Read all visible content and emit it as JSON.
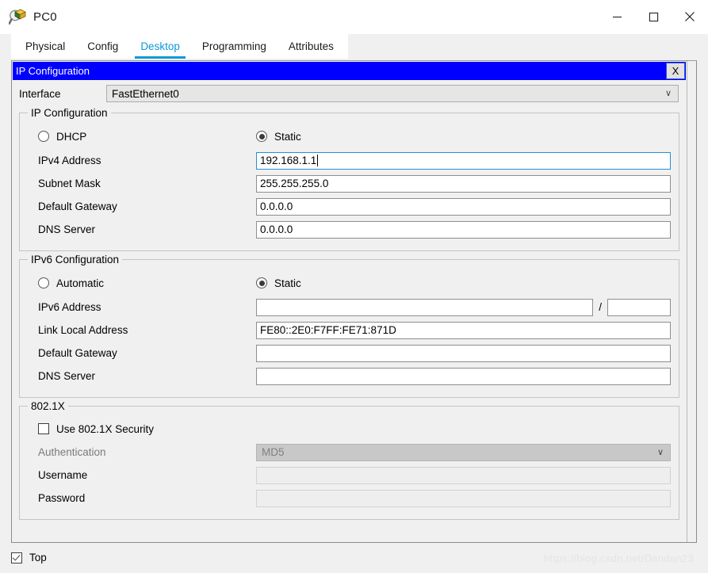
{
  "window": {
    "title": "PC0",
    "icon": "packet-tracer-inspect-icon",
    "controls": {
      "minimize": "—",
      "maximize": "□",
      "close": "✕"
    }
  },
  "tabs": [
    {
      "label": "Physical",
      "active": false
    },
    {
      "label": "Config",
      "active": false
    },
    {
      "label": "Desktop",
      "active": true
    },
    {
      "label": "Programming",
      "active": false
    },
    {
      "label": "Attributes",
      "active": false
    }
  ],
  "dialog": {
    "title": "IP Configuration",
    "close_label": "X",
    "accent_color": "#0000ff",
    "interface": {
      "label": "Interface",
      "value": "FastEthernet0",
      "chevron": "∨"
    }
  },
  "ipv4": {
    "group_title": "IP Configuration",
    "modes": [
      {
        "label": "DHCP",
        "selected": false
      },
      {
        "label": "Static",
        "selected": true
      }
    ],
    "fields": [
      {
        "label": "IPv4 Address",
        "value": "192.168.1.1",
        "focused": true,
        "disabled": false
      },
      {
        "label": "Subnet Mask",
        "value": "255.255.255.0",
        "focused": false,
        "disabled": false
      },
      {
        "label": "Default Gateway",
        "value": "0.0.0.0",
        "focused": false,
        "disabled": false
      },
      {
        "label": "DNS Server",
        "value": "0.0.0.0",
        "focused": false,
        "disabled": false
      }
    ]
  },
  "ipv6": {
    "group_title": "IPv6 Configuration",
    "modes": [
      {
        "label": "Automatic",
        "selected": false
      },
      {
        "label": "Static",
        "selected": true
      }
    ],
    "address": {
      "label": "IPv6 Address",
      "value": "",
      "prefix": "",
      "separator": "/"
    },
    "fields": [
      {
        "label": "Link Local Address",
        "value": "FE80::2E0:F7FF:FE71:871D"
      },
      {
        "label": "Default Gateway",
        "value": ""
      },
      {
        "label": "DNS Server",
        "value": ""
      }
    ]
  },
  "dot1x": {
    "group_title": "802.1X",
    "use_security": {
      "label": "Use 802.1X Security",
      "checked": false
    },
    "authentication": {
      "label": "Authentication",
      "value": "MD5",
      "chevron": "∨",
      "disabled": true
    },
    "username": {
      "label": "Username",
      "value": "",
      "disabled": true
    },
    "password": {
      "label": "Password",
      "value": "",
      "disabled": true
    }
  },
  "bottom": {
    "top_checkbox": {
      "label": "Top",
      "checked": true
    },
    "watermark": "https://blog.csdn.net/Dandan23"
  }
}
